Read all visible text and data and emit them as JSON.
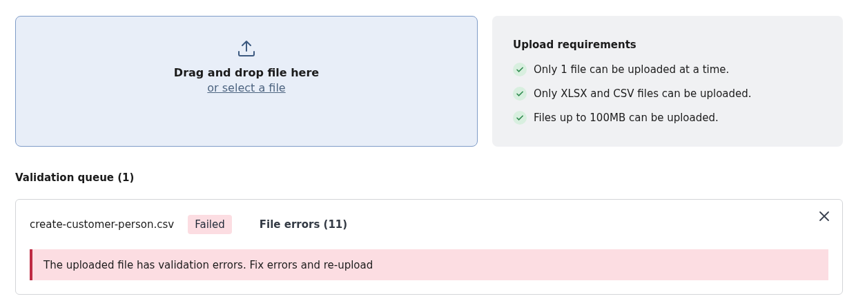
{
  "dropzone": {
    "title": "Drag and drop file here",
    "link": "or select a file"
  },
  "requirements": {
    "title": "Upload requirements",
    "items": [
      {
        "text": "Only 1 file can be uploaded at a time.",
        "met": true
      },
      {
        "text": "Only XLSX and CSV files can be uploaded.",
        "met": true
      },
      {
        "text": "Files up to 100MB can be uploaded.",
        "met": true
      }
    ]
  },
  "queue": {
    "title": "Validation queue (1)",
    "items": [
      {
        "file": "create-customer-person.csv",
        "status": "Failed",
        "kind": "failed",
        "errors_link": "File errors (11)",
        "message": "The uploaded file has validation errors. Fix errors and re-upload"
      }
    ]
  }
}
